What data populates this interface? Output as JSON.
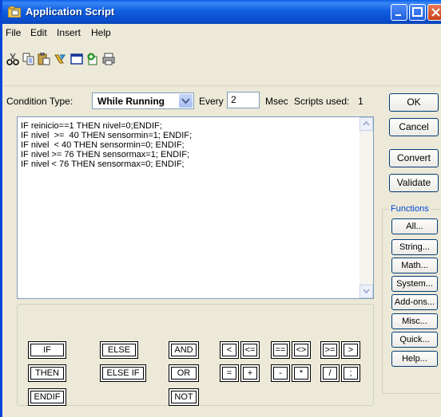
{
  "window": {
    "title": "Application Script"
  },
  "menu": [
    "File",
    "Edit",
    "Insert",
    "Help"
  ],
  "toolbar": {
    "icons": [
      "cut-icon",
      "copy-icon",
      "paste-icon",
      "pick-icon",
      "window-icon",
      "add-icon",
      "print-icon"
    ]
  },
  "condition": {
    "type_label": "Condition Type:",
    "type_value": "While Running",
    "every_label": "Every",
    "every_value": "2",
    "msec_label": "Msec",
    "scripts_used_label": "Scripts used:",
    "scripts_used_value": "1"
  },
  "script": {
    "lines": [
      "IF reinicio==1 THEN nivel=0;ENDIF;",
      "IF nivel  >=  40 THEN sensormin=1; ENDIF;",
      "IF nivel  < 40 THEN sensormin=0; ENDIF;",
      "IF nivel >= 76 THEN sensormax=1; ENDIF;",
      "IF nivel < 76 THEN sensormax=0; ENDIF;"
    ]
  },
  "actions": {
    "ok": "OK",
    "cancel": "Cancel",
    "convert": "Convert",
    "validate": "Validate"
  },
  "functions": {
    "legend": "Functions",
    "all": "All...",
    "string": "String...",
    "math": "Math...",
    "system": "System...",
    "addons": "Add-ons...",
    "misc": "Misc...",
    "quick": "Quick...",
    "help": "Help..."
  },
  "operators": {
    "if": "IF",
    "then": "THEN",
    "endif": "ENDIF",
    "else": "ELSE",
    "elseif": "ELSE IF",
    "and": "AND",
    "or": "OR",
    "not": "NOT",
    "lt": "<",
    "le": "<=",
    "eq": "==",
    "ne": "<>",
    "ge": ">=",
    "gt": ">",
    "assign": "=",
    "plus": "+",
    "minus": "-",
    "mult": "*",
    "div": "/",
    "semicolon": ";"
  }
}
